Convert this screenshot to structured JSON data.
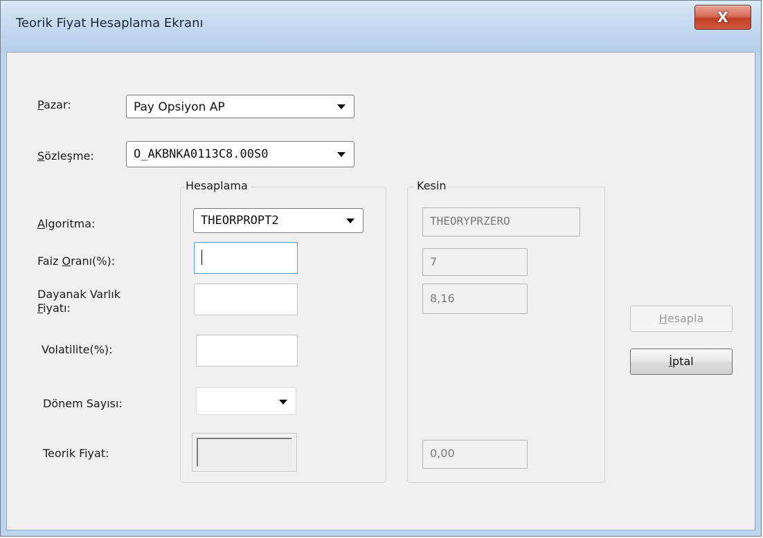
{
  "window": {
    "title": "Teorik Fiyat Hesaplama Ekranı",
    "close_glyph": "X"
  },
  "form": {
    "pazar": {
      "label_u": "P",
      "label_rest": "azar:",
      "value": "Pay Opsiyon AP"
    },
    "sozlesme": {
      "label_u": "S",
      "label_rest": "özleşme:",
      "value": "O_AKBNKA0113C8.00S0"
    },
    "algoritma": {
      "label_u": "A",
      "label_rest": "lgoritma:",
      "value": "THEORPROPT2"
    },
    "faiz": {
      "label_pre": "Faiz ",
      "label_u": "O",
      "label_rest": "ranı(%):",
      "value": ""
    },
    "dayanak": {
      "label_line1": "Dayanak Varlık",
      "label_u": "F",
      "label_rest": "iyatı:",
      "value": ""
    },
    "volatilite": {
      "label": "Volatilite(%):",
      "value": ""
    },
    "donem": {
      "label": "Dönem Sayısı:",
      "value": ""
    },
    "teorik": {
      "label": "Teorik Fiyat:",
      "value": ""
    }
  },
  "groups": {
    "hesaplama_title": "Hesaplama",
    "kesin_title": "Kesin"
  },
  "kesin": {
    "algoritma": "THEORYPRZERO",
    "faiz": "7",
    "dayanak": "8,16",
    "teorik": "0,00"
  },
  "buttons": {
    "hesapla_u": "H",
    "hesapla_rest": "esapla",
    "hesapla_enabled": false,
    "iptal_u": "İ",
    "iptal_rest": "ptal",
    "iptal_enabled": true
  }
}
